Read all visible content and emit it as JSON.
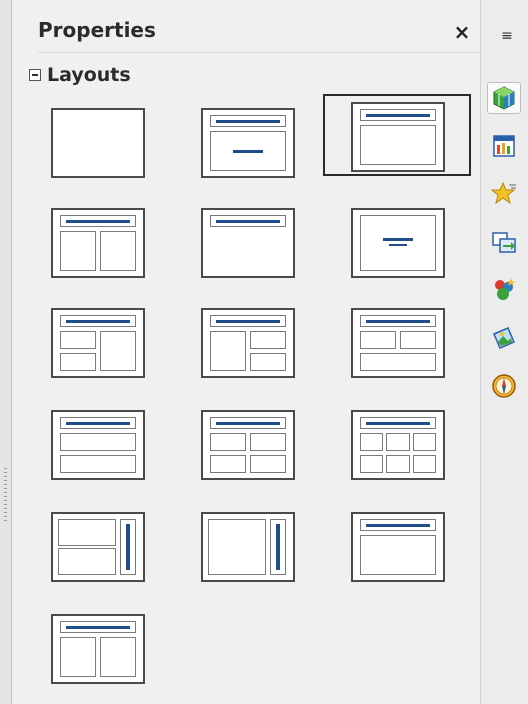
{
  "panel": {
    "title": "Properties",
    "close_label": "×"
  },
  "section": {
    "title": "Layouts",
    "collapse_glyph": "−"
  },
  "layouts": [
    "Blank Slide",
    "Title Slide",
    "Title, Content",
    "Title and 2 Content",
    "Title Only",
    "Centered Text",
    "Title, 2 Content and Content",
    "Title, Content and 2 Content",
    "Title, 2 Content over Content",
    "Title, Content over Content",
    "Title, 4 Content",
    "Title, 6 Content",
    "Vertical Title, Vertical Text",
    "Vertical Title, Text, Chart",
    "Title, Vertical Text",
    "Title, Vertical Text, Clipart"
  ],
  "selected_layout": 2,
  "sidebar": {
    "menu_glyph": "≡",
    "tabs": [
      "properties-icon",
      "master-slides-icon",
      "custom-animation-icon",
      "slide-transition-icon",
      "styles-icon",
      "gallery-icon",
      "navigator-icon"
    ],
    "active_tab": 0
  },
  "colors": {
    "accent": "#1f4e89",
    "panel_bg": "#f0f0f0",
    "sidebar_bg": "#ececec"
  }
}
